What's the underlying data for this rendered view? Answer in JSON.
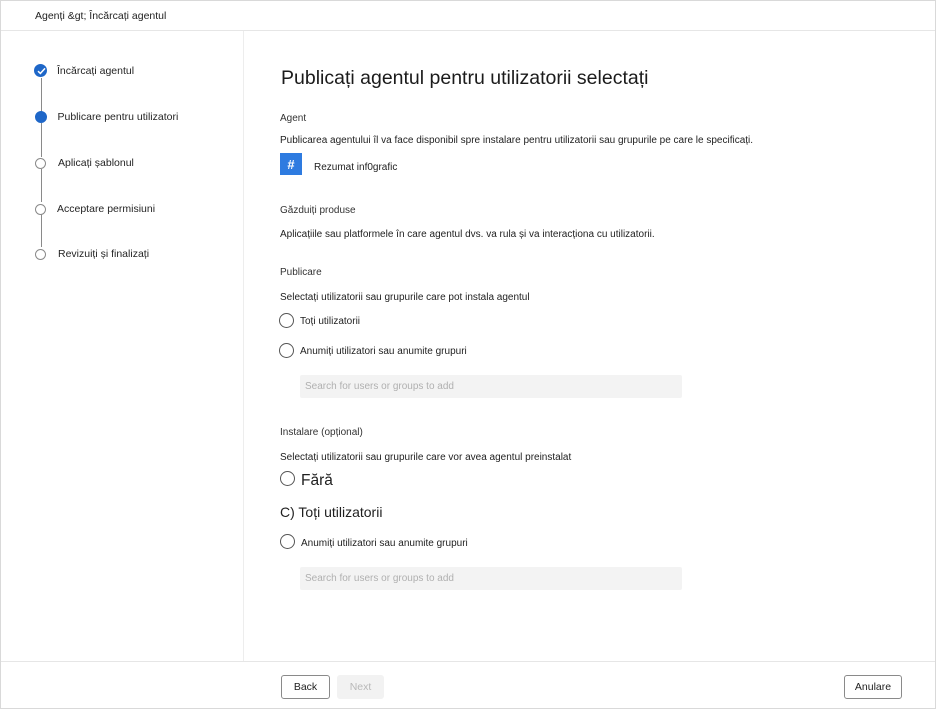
{
  "breadcrumb": "Agenți &gt; Încărcați agentul",
  "steps": [
    {
      "label": "Încărcați agentul",
      "state": "done"
    },
    {
      "label": "Publicare pentru utilizatori",
      "state": "current"
    },
    {
      "label": "Aplicați șablonul",
      "state": "pending"
    },
    {
      "label": "Acceptare permisiuni",
      "state": "pending"
    },
    {
      "label": "Revizuiți și finalizați",
      "state": "pending"
    }
  ],
  "main": {
    "title": "Publicați agentul pentru utilizatorii selectați",
    "agent_heading": "Agent",
    "agent_description": "Publicarea agentului îl va face disponibil spre instalare pentru utilizatorii sau grupurile pe care le specificați.",
    "agent_icon": "#",
    "agent_name": "Rezumat inf0grafic",
    "hosts_heading": "Găzduiți produse",
    "hosts_description": "Aplicațiile sau platformele în care agentul dvs. va rula și va interacționa cu utilizatorii.",
    "publish_heading": "Publicare",
    "publish_description": "Selectați utilizatorii sau grupurile care pot instala agentul",
    "publish_options": [
      "Toți utilizatorii",
      "Anumiți utilizatori sau anumite grupuri"
    ],
    "publish_search_placeholder": "Search for users or groups to add",
    "install_heading": "Instalare (opțional)",
    "install_description": "Selectați utilizatorii sau grupurile care vor avea agentul preinstalat",
    "install_option_none": "Fără",
    "install_option_all": "C) Toți utilizatorii",
    "install_option_specific": "Anumiți utilizatori sau anumite grupuri",
    "install_search_placeholder": "Search for users or groups to add"
  },
  "footer": {
    "back_label": "Back",
    "next_label": "Next",
    "cancel_label": "Anulare"
  },
  "colors": {
    "accent": "#1f67c8",
    "agent_tile": "#2e7be0"
  }
}
